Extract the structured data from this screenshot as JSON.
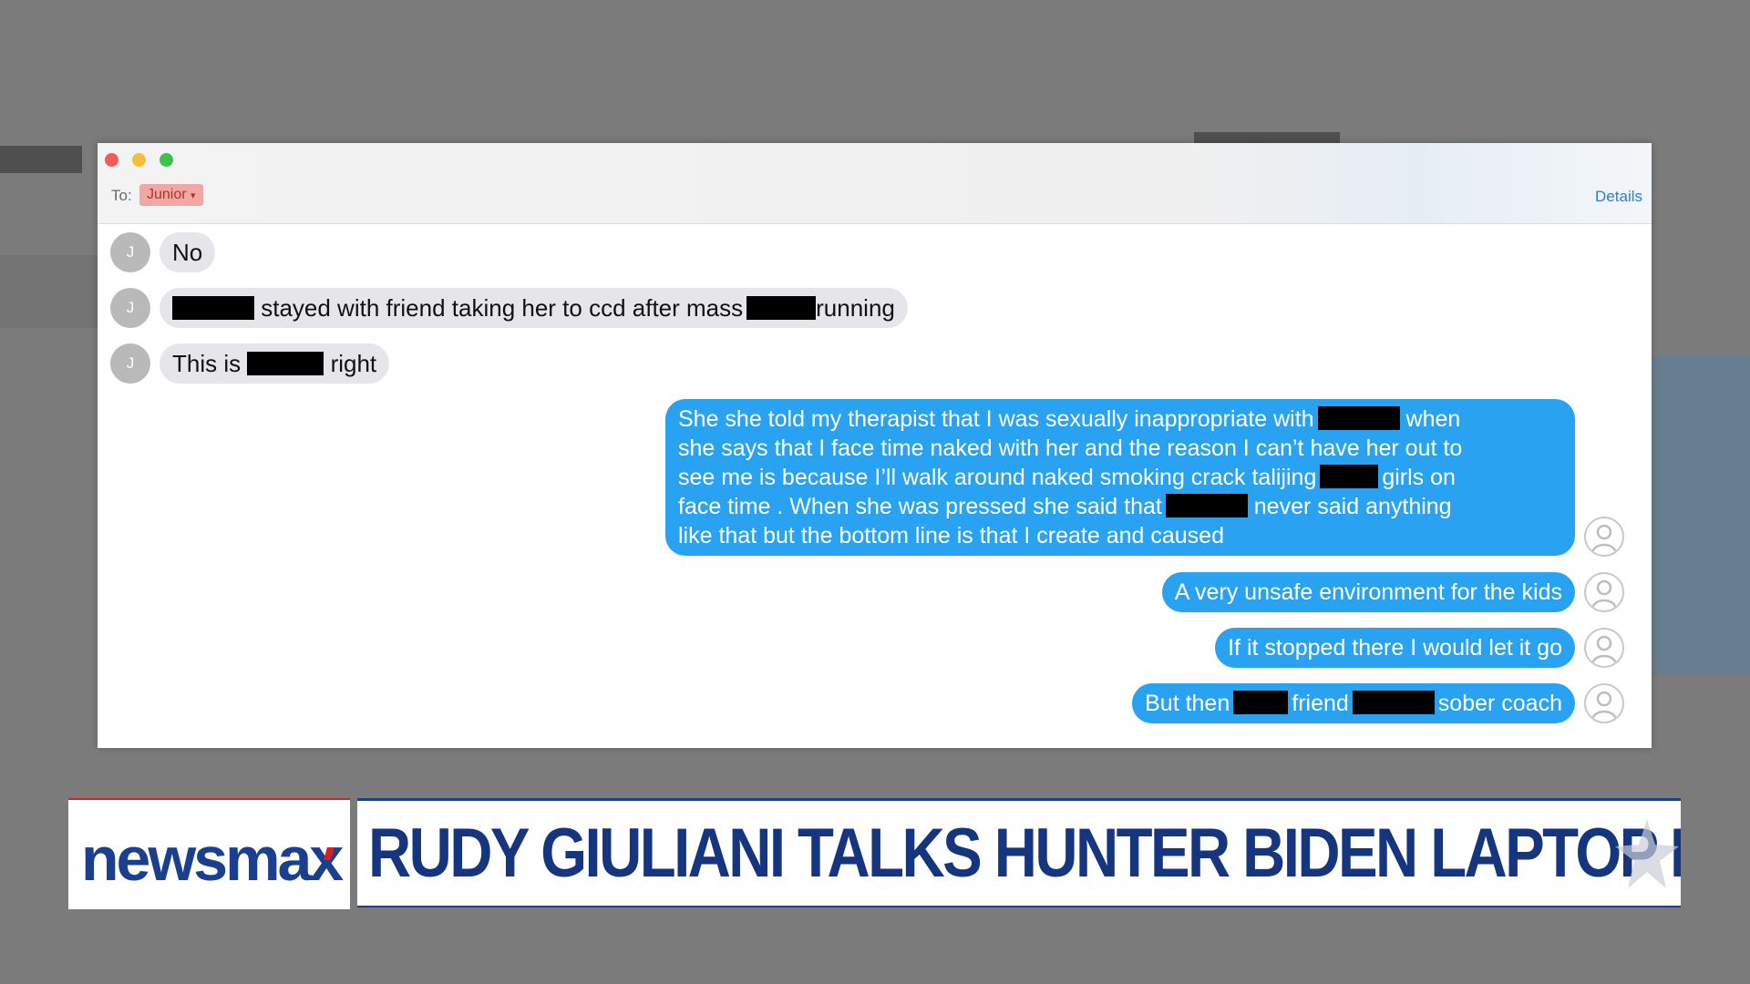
{
  "window": {
    "to_label": "To:",
    "recipient": "Junior",
    "details_label": "Details"
  },
  "incoming": [
    {
      "avatar": "J",
      "parts": [
        "No"
      ]
    },
    {
      "avatar": "J",
      "parts": [
        "",
        " stayed with friend taking her to ccd after mass",
        "running"
      ]
    },
    {
      "avatar": "J",
      "parts": [
        "This is ",
        " right"
      ]
    }
  ],
  "outgoing": [
    {
      "lines": [
        [
          "She she told my therapist that I was sexually inappropriate with",
          " when"
        ],
        [
          "she says that I face time naked with her and the reason I can’t have her out to"
        ],
        [
          "see me is because I’ll walk around naked smoking crack talijing",
          "girls on"
        ],
        [
          "face time . When she was pressed she said that",
          " never said anything"
        ],
        [
          "like that but the bottom line is that I create and caused"
        ]
      ]
    },
    {
      "lines": [
        [
          "A very unsafe environment for the kids"
        ]
      ]
    },
    {
      "lines": [
        [
          "If it stopped there I would let it go"
        ]
      ]
    },
    {
      "lines": [
        [
          "But then",
          "friend",
          "sober coach"
        ]
      ]
    }
  ],
  "network": {
    "logo": "newsmax",
    "brand_color": "#1b3f8f",
    "accent_color": "#d42027"
  },
  "chyron": {
    "headline": "RUDY GIULIANI TALKS HUNTER BIDEN LAPTOP DOCS"
  }
}
